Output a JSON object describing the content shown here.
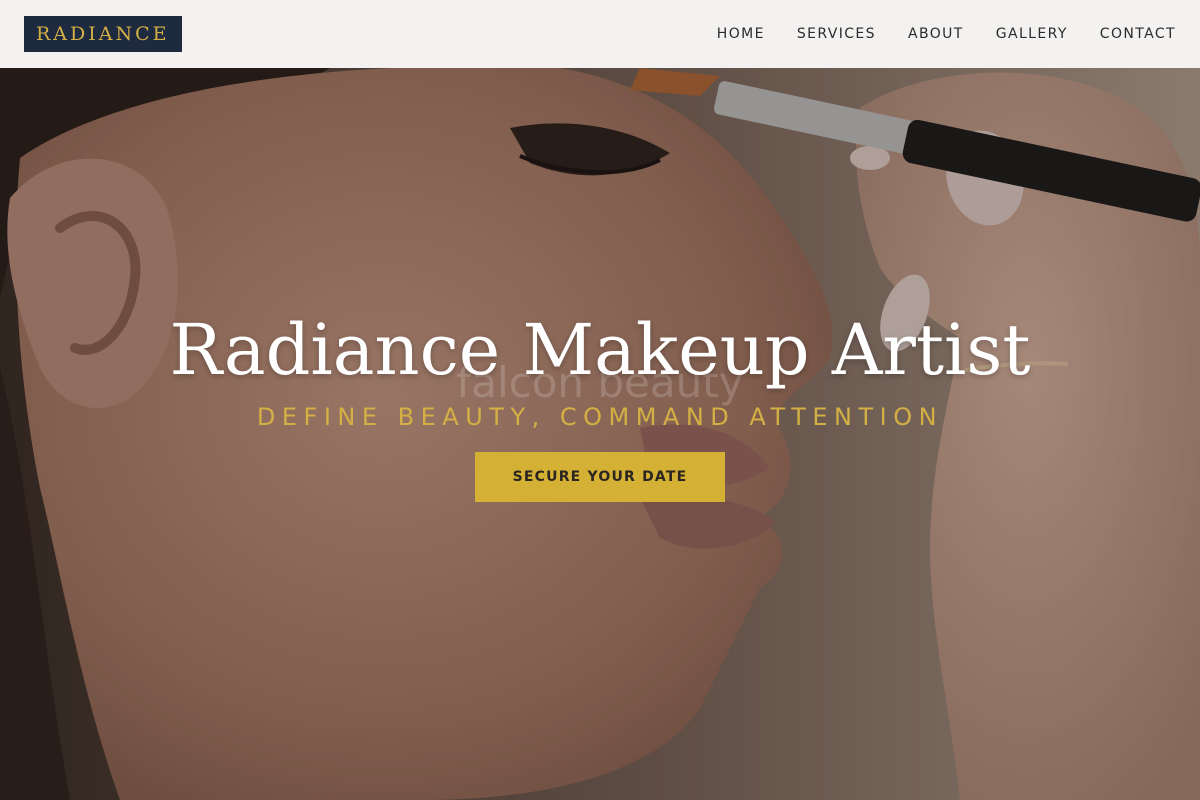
{
  "brand": {
    "logo_text": "RADIANCE"
  },
  "nav": {
    "items": [
      {
        "label": "HOME"
      },
      {
        "label": "SERVICES"
      },
      {
        "label": "ABOUT"
      },
      {
        "label": "GALLERY"
      },
      {
        "label": "CONTACT"
      }
    ]
  },
  "hero": {
    "title": "Radiance Makeup Artist",
    "subtitle": "DEFINE BEAUTY, COMMAND ATTENTION",
    "cta_label": "SECURE YOUR DATE",
    "watermark": "falcon beauty",
    "photo_alt": "makeup-brush-face-profile"
  },
  "colors": {
    "navy": "#1e2a3f",
    "gold": "#d4b044",
    "button_gold": "#d4b034",
    "header_bg": "#f3f2f1"
  }
}
